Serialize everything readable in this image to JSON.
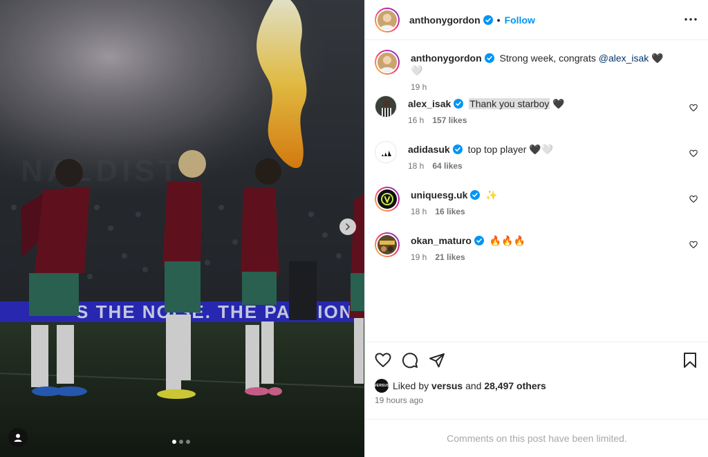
{
  "post": {
    "author": "anthonygordon",
    "follow_label": "Follow",
    "separator": "•"
  },
  "caption": {
    "username": "anthonygordon",
    "text": "Strong week, congrats",
    "mention": "@alex_isak",
    "emoji": "🖤🤍",
    "time": "19 h"
  },
  "comments": [
    {
      "username": "alex_isak",
      "text": "Thank you starboy",
      "emoji": "🖤",
      "time": "16 h",
      "likes": "157 likes"
    },
    {
      "username": "adidasuk",
      "text": "top top player",
      "emoji": "🖤🤍",
      "time": "18 h",
      "likes": "64 likes"
    },
    {
      "username": "uniquesg.uk",
      "text": "",
      "emoji": "✨",
      "time": "18 h",
      "likes": "16 likes"
    },
    {
      "username": "okan_maturo",
      "text": "",
      "emoji": "🔥🔥🔥",
      "time": "19 h",
      "likes": "21 likes"
    }
  ],
  "likes_line": {
    "prefix": "Liked by",
    "user": "versus",
    "conjunction": "and",
    "others": "28,497 others"
  },
  "post_time": "19 hours ago",
  "comments_limited": "Comments on this post have been limited.",
  "banner_text": "S THE NOISE. THE PASSION",
  "avatar_badge_versus": "VERSUS",
  "carousel": {
    "total": 3,
    "active": 1
  },
  "colors": {
    "accent": "#0095f6",
    "verified": "#0095f6",
    "mention": "#00376b",
    "muted": "#737373",
    "kit_red": "#6b1422",
    "kit_green": "#2f6e5c"
  }
}
